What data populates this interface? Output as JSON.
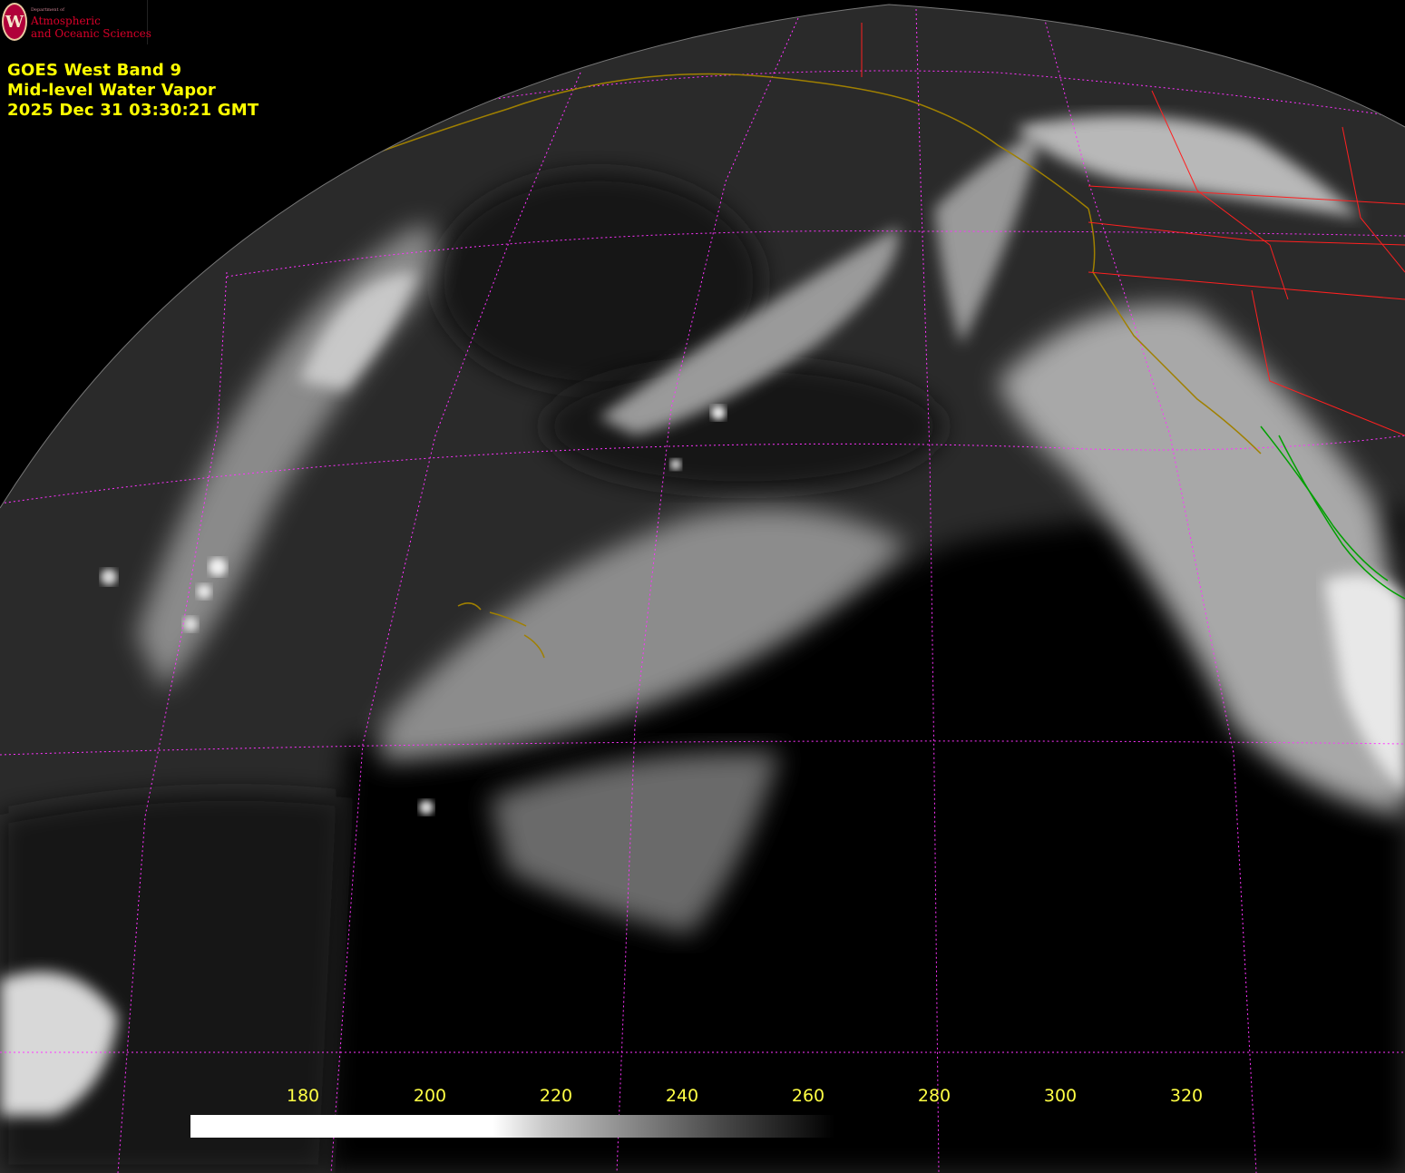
{
  "logo": {
    "department": "Department of",
    "line1": "Atmospheric",
    "line2": "and Oceanic Sciences",
    "seal_letter": "W"
  },
  "caption": {
    "line1": "GOES West Band 9",
    "line2": "Mid-level Water Vapor",
    "line3": "2025 Dec 31  03:30:21 GMT"
  },
  "colorbar": {
    "ticks": [
      "180",
      "200",
      "220",
      "240",
      "260",
      "280",
      "300",
      "320"
    ],
    "gradient": "white-to-black"
  },
  "colors": {
    "caption": "#ffff00",
    "grid": "#ff33ff",
    "coastline": "#a08000",
    "state_borders": "#ff2020",
    "mexico_coast": "#00a000"
  }
}
